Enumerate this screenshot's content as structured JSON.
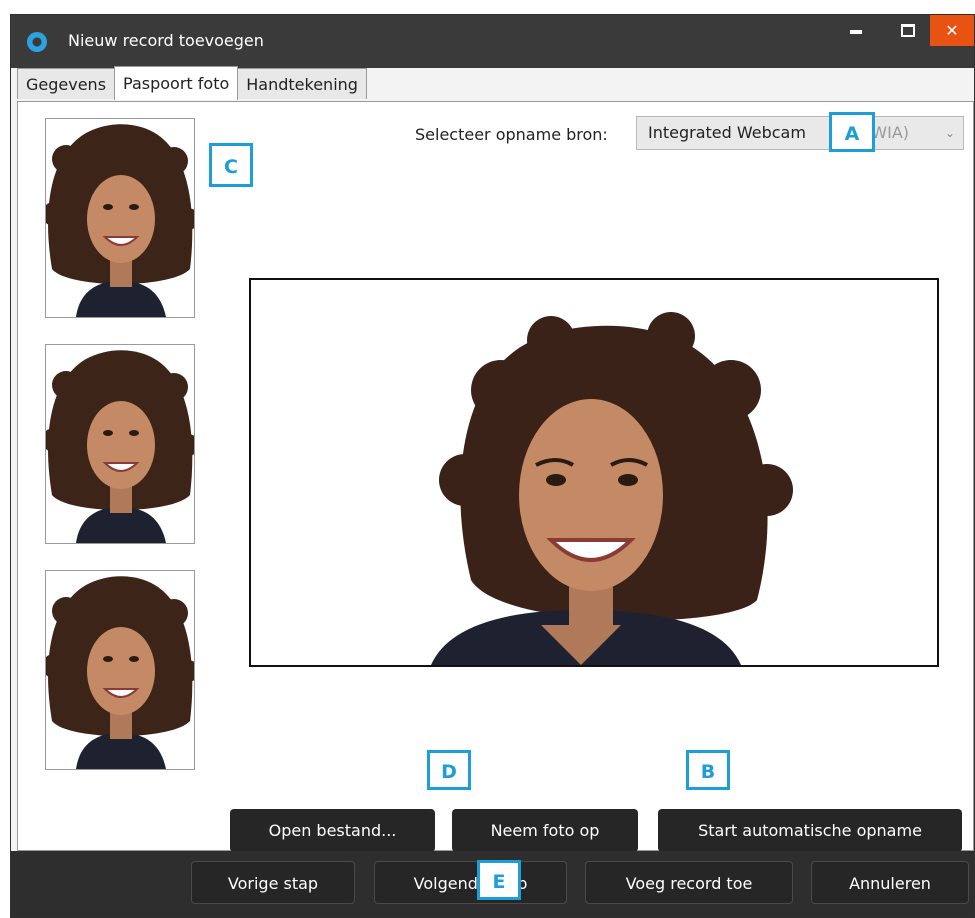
{
  "window": {
    "title": "Nieuw record toevoegen"
  },
  "tabs": [
    {
      "label": "Gegevens"
    },
    {
      "label": "Paspoort foto"
    },
    {
      "label": "Handtekening"
    }
  ],
  "source": {
    "label": "Selecteer opname bron:",
    "selected_main": "Integrated Webcam",
    "selected_suffix": "(WIA)"
  },
  "actions": {
    "open_file": "Open bestand...",
    "take_photo": "Neem foto op",
    "auto_capture": "Start automatische opname"
  },
  "footer": {
    "previous": "Vorige stap",
    "next": "Volgende stap",
    "add_record": "Voeg record toe",
    "cancel": "Annuleren"
  },
  "callouts": {
    "a": "A",
    "b": "B",
    "c": "C",
    "d": "D",
    "e": "E"
  },
  "colors": {
    "titlebar": "#3a3a3a",
    "close": "#e85314",
    "callout": "#1e9ed8",
    "button": "#262626"
  }
}
